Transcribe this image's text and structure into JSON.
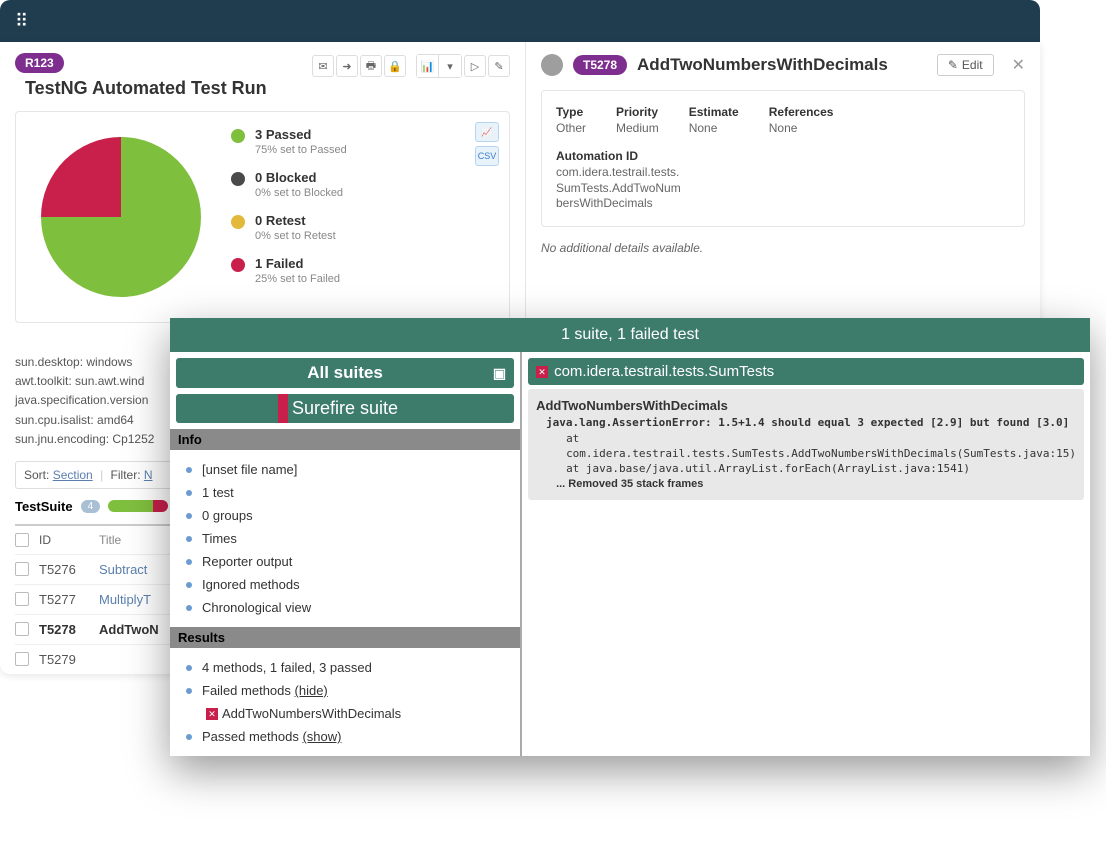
{
  "header": {
    "logo": "grid-icon"
  },
  "run": {
    "badge": "R123",
    "title": "TestNG Automated Test Run"
  },
  "chart_data": {
    "type": "pie",
    "title": "",
    "categories": [
      "Passed",
      "Blocked",
      "Retest",
      "Failed"
    ],
    "values": [
      3,
      0,
      0,
      1
    ],
    "colors": [
      "#7fbf3e",
      "#4a4a4a",
      "#e2b93b",
      "#c8204a"
    ]
  },
  "legend": [
    {
      "label": "3 Passed",
      "sub": "75% set to Passed",
      "color": "#7fbf3e"
    },
    {
      "label": "0 Blocked",
      "sub": "0% set to Blocked",
      "color": "#4a4a4a"
    },
    {
      "label": "0 Retest",
      "sub": "0% set to Retest",
      "color": "#e2b93b"
    },
    {
      "label": "1 Failed",
      "sub": "25% set to Failed",
      "color": "#c8204a"
    }
  ],
  "export": {
    "img": "📊",
    "csv": "CSV"
  },
  "sys_props": [
    "sun.desktop: windows",
    "awt.toolkit: sun.awt.wind",
    "java.specification.version",
    "sun.cpu.isalist: amd64",
    "sun.jnu.encoding: Cp1252"
  ],
  "sort_filter": {
    "sort_label": "Sort:",
    "sort_value": "Section",
    "filter_label": "Filter:",
    "filter_value": "N"
  },
  "suite": {
    "name": "TestSuite",
    "count": "4",
    "pass_pct": 75,
    "fail_pct": 25
  },
  "test_table": {
    "headers": {
      "id": "ID",
      "title": "Title"
    },
    "rows": [
      {
        "id": "T5276",
        "title": "Subtract",
        "bold": false
      },
      {
        "id": "T5277",
        "title": "MultiplyT",
        "bold": false
      },
      {
        "id": "T5278",
        "title": "AddTwoN",
        "bold": true
      },
      {
        "id": "T5279",
        "title": "",
        "bold": false
      }
    ]
  },
  "detail": {
    "badge": "T5278",
    "title": "AddTwoNumbersWithDecimals",
    "edit": "Edit",
    "fields": {
      "type_label": "Type",
      "type_value": "Other",
      "priority_label": "Priority",
      "priority_value": "Medium",
      "estimate_label": "Estimate",
      "estimate_value": "None",
      "references_label": "References",
      "references_value": "None",
      "automation_id_label": "Automation ID",
      "automation_id_value": "com.idera.testrail.tests.SumTests.AddTwoNumbersWithDecimals"
    },
    "no_details": "No additional details available."
  },
  "report": {
    "header": "1 suite, 1 failed test",
    "all_suites": "All suites",
    "surefire": "Surefire suite",
    "info_label": "Info",
    "info_items": [
      "[unset file name]",
      "1 test",
      "0 groups",
      "Times",
      "Reporter output",
      "Ignored methods",
      "Chronological view"
    ],
    "results_label": "Results",
    "results_summary": "4 methods, 1 failed, 3 passed",
    "failed_label": "Failed methods",
    "failed_toggle": "(hide)",
    "failed_method": "AddTwoNumbersWithDecimals",
    "passed_label": "Passed methods",
    "passed_toggle": "(show)",
    "right_title": "com.idera.testrail.tests.SumTests",
    "stack": {
      "method": "AddTwoNumbersWithDecimals",
      "error": "java.lang.AssertionError: 1.5+1.4 should equal 3 expected [2.9] but found [3.0]",
      "line1": "at com.idera.testrail.tests.SumTests.AddTwoNumbersWithDecimals(SumTests.java:15)",
      "line2": "at java.base/java.util.ArrayList.forEach(ArrayList.java:1541)",
      "removed": "... Removed 35 stack frames"
    }
  }
}
